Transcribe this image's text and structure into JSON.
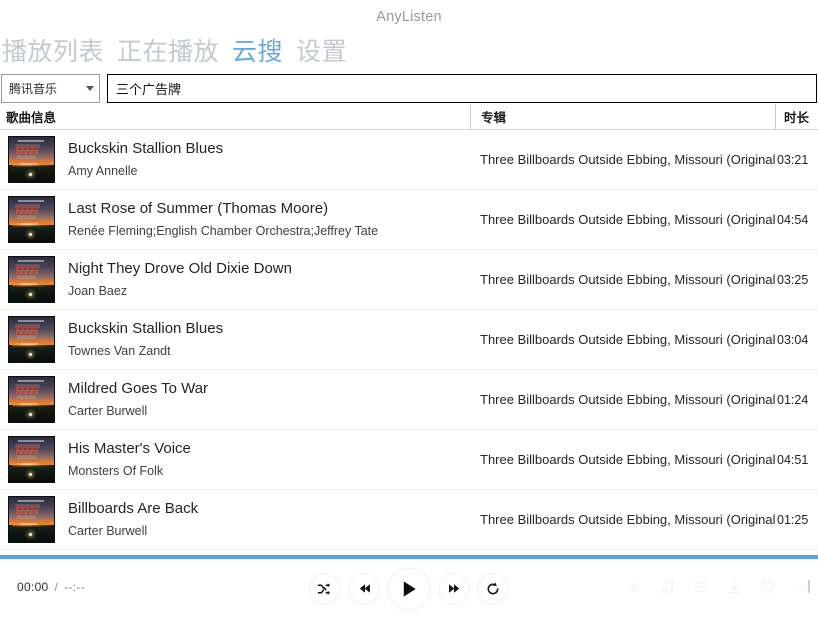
{
  "window": {
    "title": "AnyListen"
  },
  "nav": {
    "tabs": [
      {
        "label": "播放列表",
        "name": "tab-playlist",
        "active": false
      },
      {
        "label": "正在播放",
        "name": "tab-now-playing",
        "active": false
      },
      {
        "label": "云搜",
        "name": "tab-cloud-search",
        "active": true
      },
      {
        "label": "设置",
        "name": "tab-settings",
        "active": false
      }
    ],
    "active_color": "#6aa9dd",
    "inactive_color": "#c4c9cf"
  },
  "search": {
    "source_label": "腾讯音乐",
    "query": "三个广告牌",
    "placeholder": ""
  },
  "table": {
    "headers": {
      "song": "歌曲信息",
      "album": "专辑",
      "duration": "时长"
    },
    "rows": [
      {
        "title": "Buckskin Stallion Blues",
        "artist": "Amy Annelle",
        "album": "Three Billboards Outside Ebbing, Missouri (Original",
        "duration": "03:21"
      },
      {
        "title": "Last Rose of Summer (Thomas Moore)",
        "artist": "Renée Fleming;English Chamber Orchestra;Jeffrey Tate",
        "album": "Three Billboards Outside Ebbing, Missouri (Original",
        "duration": "04:54"
      },
      {
        "title": "Night They Drove Old Dixie Down",
        "artist": "Joan Baez",
        "album": "Three Billboards Outside Ebbing, Missouri (Original",
        "duration": "03:25"
      },
      {
        "title": "Buckskin Stallion Blues",
        "artist": "Townes Van Zandt",
        "album": "Three Billboards Outside Ebbing, Missouri (Original",
        "duration": "03:04"
      },
      {
        "title": "Mildred Goes To War",
        "artist": "Carter Burwell",
        "album": "Three Billboards Outside Ebbing, Missouri (Original",
        "duration": "01:24"
      },
      {
        "title": "His Master's Voice",
        "artist": "Monsters Of Folk",
        "album": "Three Billboards Outside Ebbing, Missouri (Original",
        "duration": "04:51"
      },
      {
        "title": "Billboards Are Back",
        "artist": "Carter Burwell",
        "album": "Three Billboards Outside Ebbing, Missouri (Original",
        "duration": "01:25"
      }
    ]
  },
  "player": {
    "current_time": "00:00",
    "separator": "/",
    "total_time": "--:--",
    "progress_percent": 100,
    "progress_color": "#5ba4d8",
    "controls": [
      {
        "name": "shuffle-button",
        "icon": "shuffle-icon"
      },
      {
        "name": "previous-button",
        "icon": "rewind-icon"
      },
      {
        "name": "play-button",
        "icon": "play-icon"
      },
      {
        "name": "next-button",
        "icon": "fast-forward-icon"
      },
      {
        "name": "repeat-button",
        "icon": "repeat-icon"
      }
    ]
  }
}
